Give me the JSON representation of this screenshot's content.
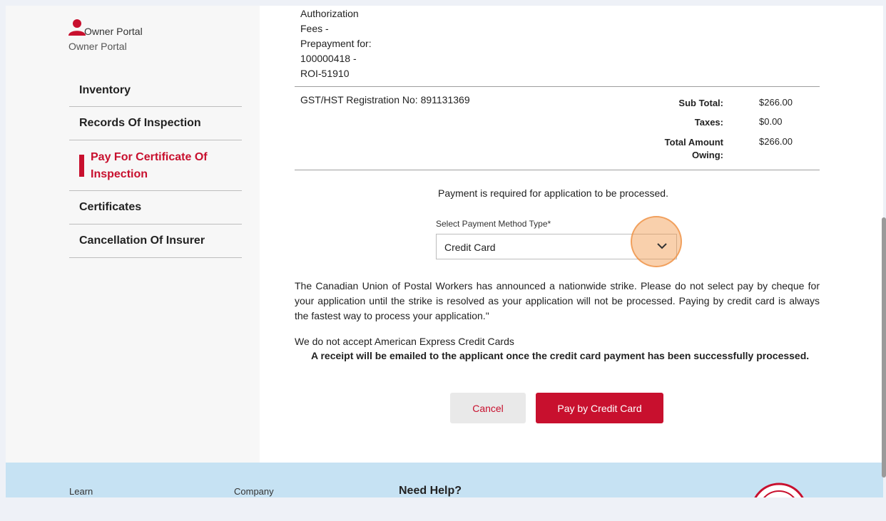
{
  "sidebar": {
    "portal_name": "Owner Portal",
    "portal_sub": "Owner Portal",
    "items": [
      {
        "label": "Inventory"
      },
      {
        "label": "Records Of Inspection"
      },
      {
        "label": "Pay For Certificate Of Inspection",
        "active": true
      },
      {
        "label": "Certificates"
      },
      {
        "label": "Cancellation Of Insurer"
      }
    ]
  },
  "invoice": {
    "description_lines": [
      "Authorization",
      "Fees -",
      "Prepayment for:",
      "100000418 -",
      "ROI-51910"
    ],
    "gst": "GST/HST Registration No: 891131369",
    "sub_total_label": "Sub Total:",
    "sub_total": "$266.00",
    "taxes_label": "Taxes:",
    "taxes": "$0.00",
    "total_label_line1": "Total Amount",
    "total_label_line2": "Owing:",
    "total": "$266.00"
  },
  "payment": {
    "notice": "Payment is required for application to be processed.",
    "method_label": "Select Payment Method Type*",
    "method_value": "Credit Card",
    "strike_notice": "The Canadian Union of Postal Workers has announced a nationwide strike. Please do not select pay by cheque for your application until the strike is resolved as your application will not be processed. Paying by credit card is always the fastest way to process your application.\"",
    "amex_notice": "We do not accept American Express Credit Cards",
    "receipt_notice": "A receipt will be emailed to the applicant once the credit card payment has been successfully processed.",
    "cancel_label": "Cancel",
    "pay_label": "Pay by Credit Card"
  },
  "footer": {
    "learn": "Learn",
    "company": "Company",
    "help": "Need Help?"
  },
  "colors": {
    "brand_red": "#c8102e",
    "footer_blue": "#c6e2f3",
    "click_highlight": "#f19646"
  },
  "icons": [
    "person-icon",
    "chevron-down-icon",
    "seal-logo"
  ]
}
